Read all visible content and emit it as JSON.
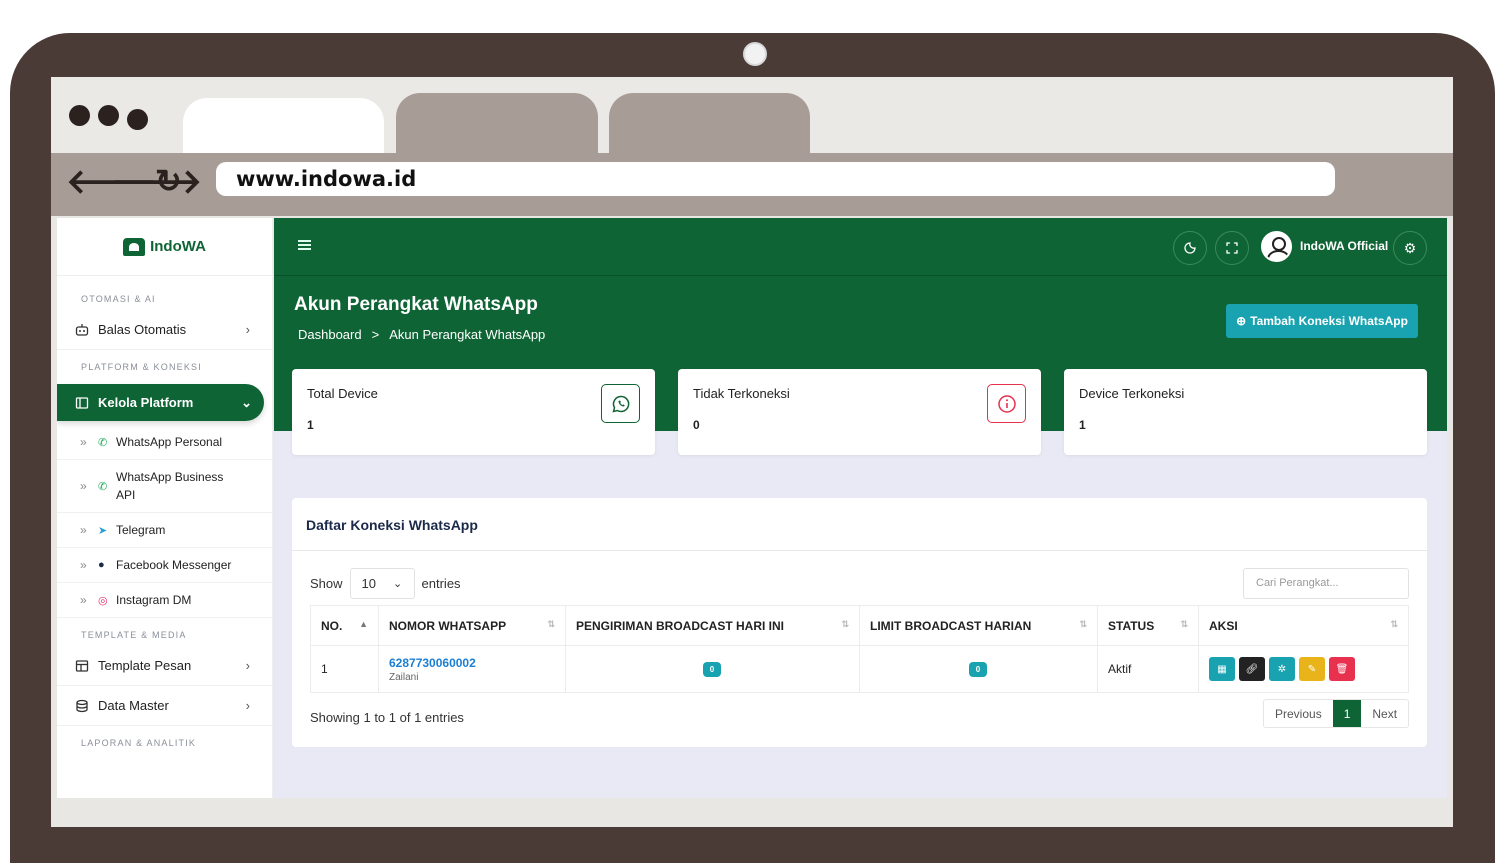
{
  "browser": {
    "url": "www.indowa.id",
    "back_icon": "arrow-left-icon",
    "forward_icon": "arrow-right-icon",
    "reload_icon": "reload-icon"
  },
  "colors": {
    "primary": "#0f6435",
    "accent": "#19a3b1",
    "danger": "#e8304f",
    "warning": "#e9b31a"
  },
  "sidebar": {
    "logo": "IndoWA",
    "sections": {
      "otomasi": "OTOMASI & AI",
      "platform": "PLATFORM & KONEKSI",
      "template": "TEMPLATE & MEDIA",
      "laporan": "LAPORAN & ANALITIK"
    },
    "items": {
      "balas": "Balas Otomatis",
      "kelola": "Kelola Platform",
      "template": "Template Pesan",
      "datamaster": "Data Master"
    },
    "subitems": [
      "WhatsApp Personal",
      "WhatsApp Business API",
      "Telegram",
      "Facebook Messenger",
      "Instagram DM"
    ]
  },
  "topbar": {
    "username": "IndoWA Official"
  },
  "page": {
    "title": "Akun Perangkat WhatsApp",
    "breadcrumb": [
      "Dashboard",
      ">",
      "Akun Perangkat WhatsApp"
    ],
    "add_button": "Tambah Koneksi WhatsApp"
  },
  "cards": [
    {
      "title": "Total Device",
      "value": "1",
      "icon": "whatsapp-icon"
    },
    {
      "title": "Tidak Terkoneksi",
      "value": "0",
      "icon": "info-icon"
    },
    {
      "title": "Device Terkoneksi",
      "value": "1"
    }
  ],
  "table": {
    "title": "Daftar Koneksi WhatsApp",
    "show_label": "Show",
    "entries_value": "10",
    "entries_label": "entries",
    "search_placeholder": "Cari Perangkat...",
    "headers": [
      "NO.",
      "NOMOR WHATSAPP",
      "PENGIRIMAN BROADCAST HARI INI",
      "LIMIT BROADCAST HARIAN",
      "STATUS",
      "AKSI"
    ],
    "rows": [
      {
        "no": "1",
        "number": "6287730060002",
        "name": "Zailani",
        "broadcast_today": "0",
        "limit": "0",
        "status": "Aktif"
      }
    ],
    "info": "Showing 1 to 1 of 1 entries",
    "pagination": {
      "prev": "Previous",
      "current": "1",
      "next": "Next"
    }
  }
}
